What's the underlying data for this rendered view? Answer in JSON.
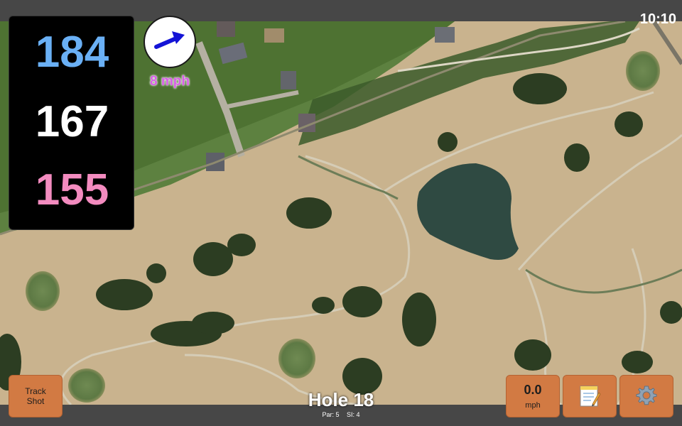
{
  "status": {
    "time": "10:10"
  },
  "distances": {
    "back": "184",
    "center": "167",
    "front": "155"
  },
  "wind": {
    "speed_label": "8 mph",
    "arrow_icon": "wind-direction-arrow"
  },
  "track_button": {
    "line1": "Track",
    "line2": "Shot"
  },
  "hole": {
    "title": "Hole 18",
    "par": "Par: 5",
    "si": "SI: 4"
  },
  "wind_button": {
    "value": "0.0",
    "unit": "mph"
  },
  "icons": {
    "notes": "notepad-icon",
    "settings": "gear-icon"
  },
  "colors": {
    "back": "#6ab0f5",
    "center": "#ffffff",
    "front": "#f38bbf",
    "button": "#d27a43",
    "wind_text": "#d85fe6"
  }
}
